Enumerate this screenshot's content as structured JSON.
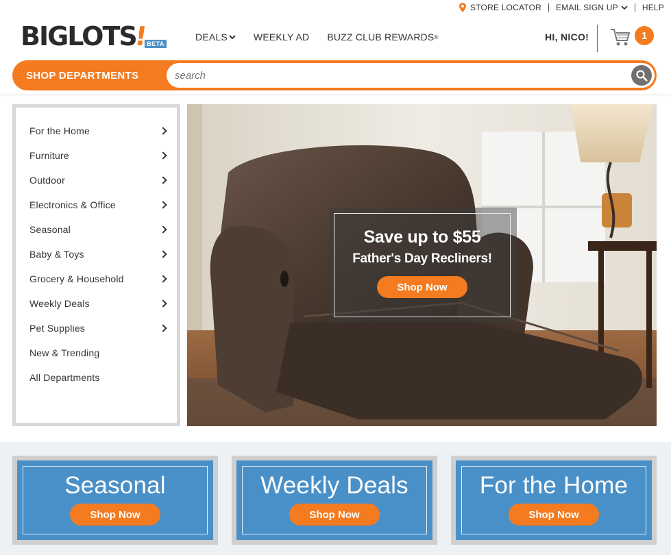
{
  "utility": {
    "store_locator": "STORE LOCATOR",
    "email_signup": "EMAIL SIGN UP",
    "help": "HELP"
  },
  "logo": {
    "text": "BIGLOTS",
    "mark": "!",
    "badge": "BETA"
  },
  "nav": {
    "deals": "DEALS",
    "weekly_ad": "WEEKLY AD",
    "buzz_club": "BUZZ CLUB REWARDS",
    "buzz_mark": "®"
  },
  "account": {
    "greeting": "HI, NICO!",
    "cart_count": "1"
  },
  "search": {
    "shop_departments": "SHOP DEPARTMENTS",
    "placeholder": "search"
  },
  "departments": [
    {
      "label": "For the Home",
      "has_arrow": true
    },
    {
      "label": "Furniture",
      "has_arrow": true
    },
    {
      "label": "Outdoor",
      "has_arrow": true
    },
    {
      "label": "Electronics & Office",
      "has_arrow": true
    },
    {
      "label": "Seasonal",
      "has_arrow": true
    },
    {
      "label": "Baby & Toys",
      "has_arrow": true
    },
    {
      "label": "Grocery & Household",
      "has_arrow": true
    },
    {
      "label": "Weekly Deals",
      "has_arrow": true
    },
    {
      "label": "Pet Supplies",
      "has_arrow": true
    },
    {
      "label": "New & Trending",
      "has_arrow": false
    },
    {
      "label": "All Departments",
      "has_arrow": false
    }
  ],
  "hero": {
    "headline": "Save up to $55",
    "subhead": "Father's Day Recliners!",
    "cta": "Shop Now"
  },
  "tiles": [
    {
      "title": "Seasonal",
      "cta": "Shop Now"
    },
    {
      "title": "Weekly Deals",
      "cta": "Shop Now"
    },
    {
      "title": "For the Home",
      "cta": "Shop Now"
    }
  ],
  "colors": {
    "brand_orange": "#f47b20",
    "brand_blue": "#4a90c8",
    "logo_dark": "#2b2b2b"
  }
}
